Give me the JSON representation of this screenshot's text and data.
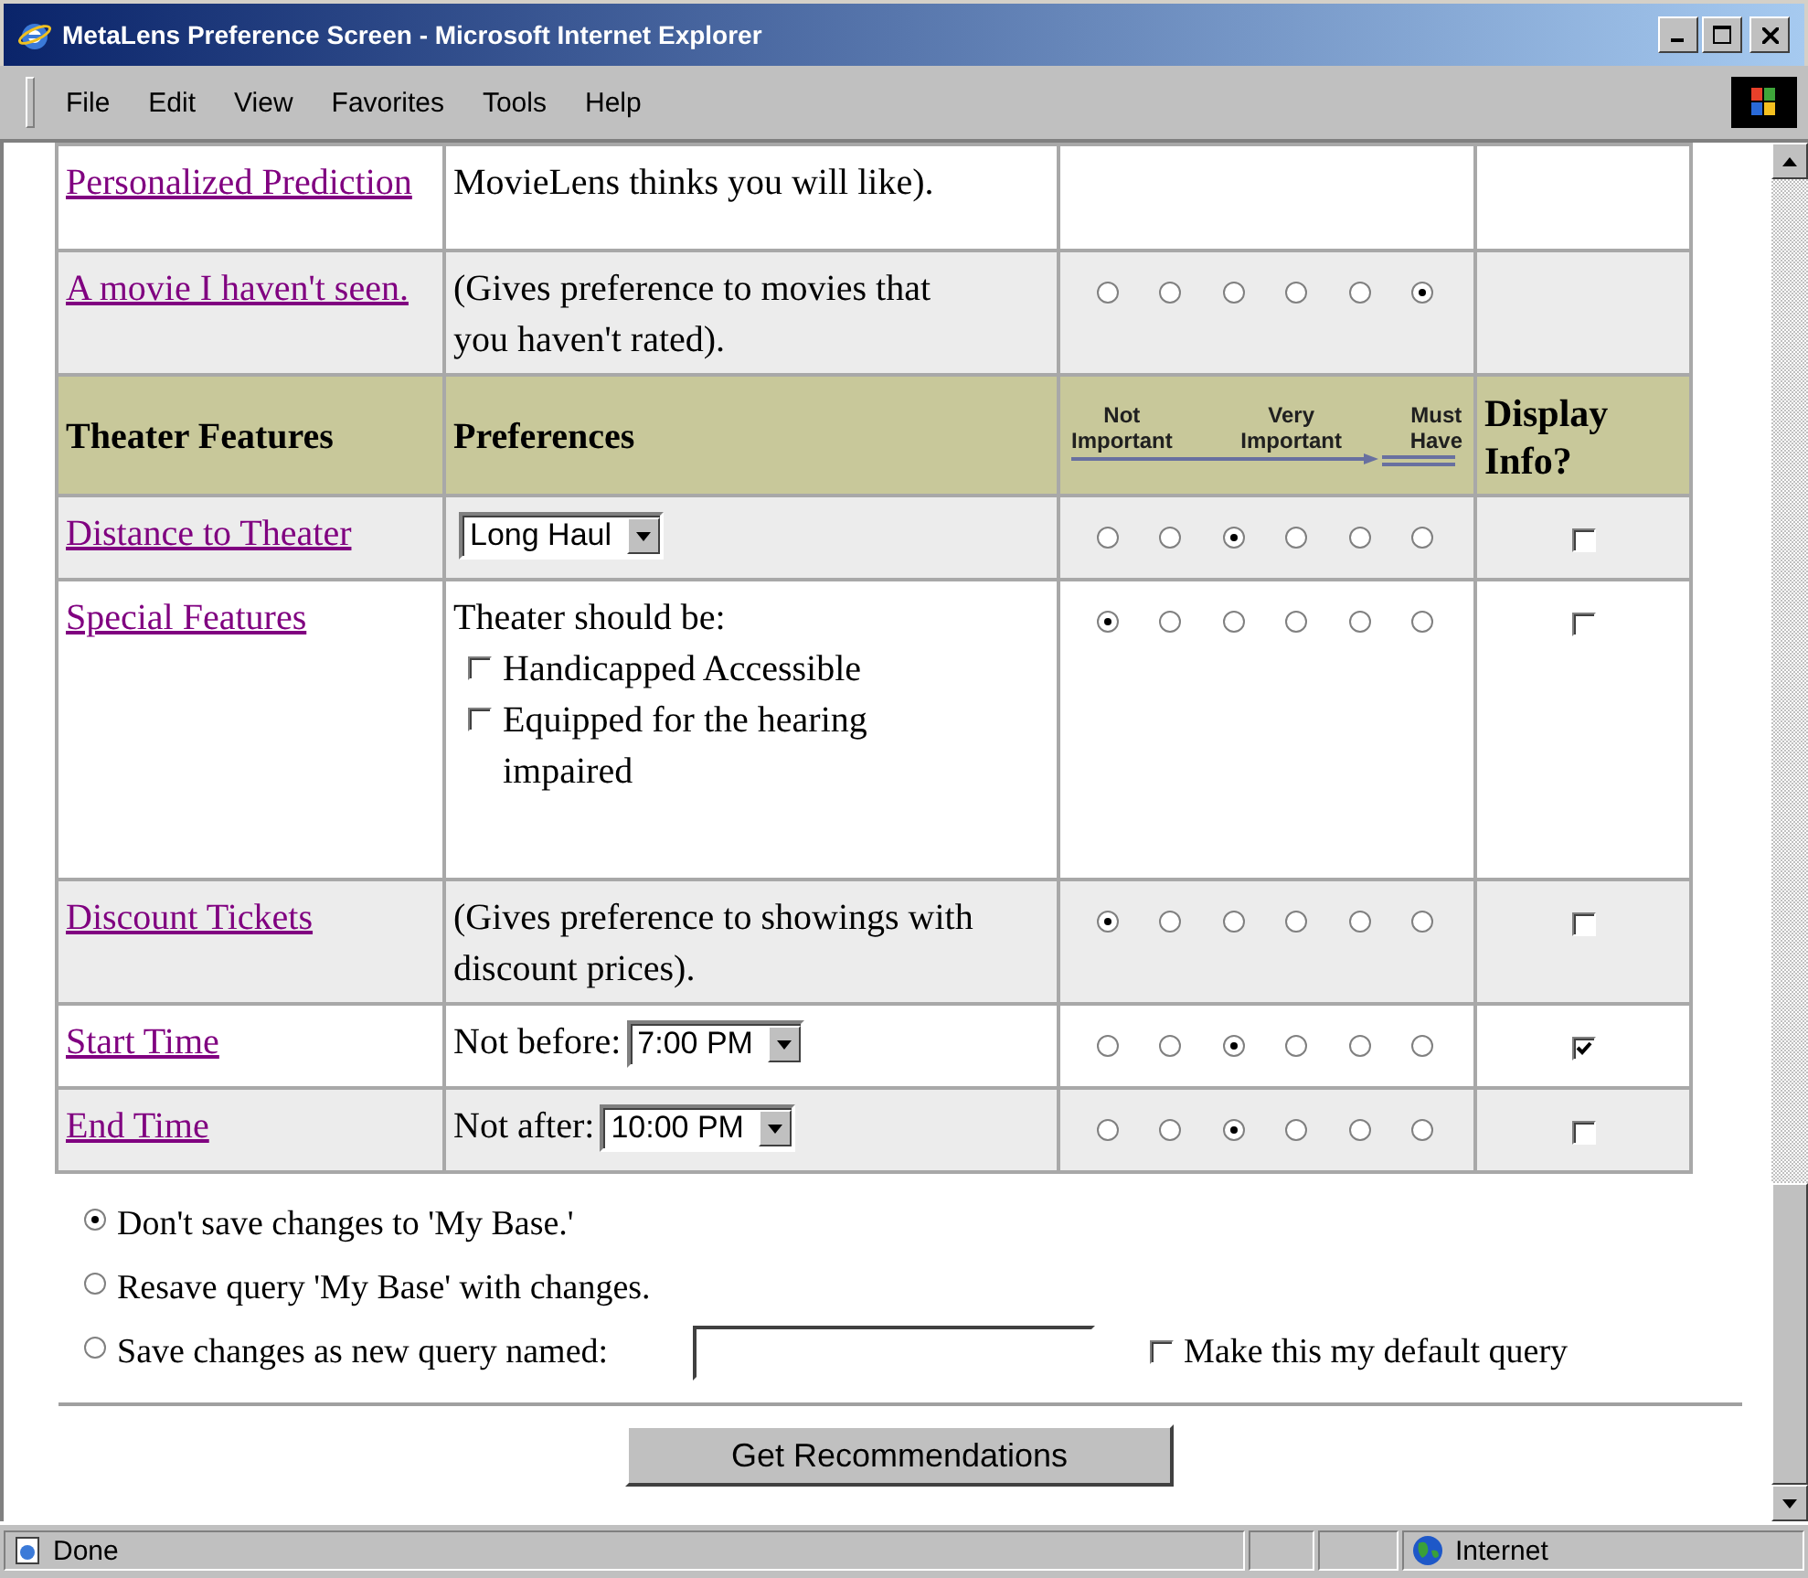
{
  "window": {
    "title": "MetaLens Preference Screen - Microsoft Internet Explorer"
  },
  "menu": [
    {
      "label": "File"
    },
    {
      "label": "Edit"
    },
    {
      "label": "View"
    },
    {
      "label": "Favorites"
    },
    {
      "label": "Tools"
    },
    {
      "label": "Help"
    }
  ],
  "movie_rows": [
    {
      "feature": "Personalized Prediction",
      "preference": {
        "kind": "text",
        "text": "MovieLens thinks you will like)."
      }
    },
    {
      "feature": "A movie I haven't seen.",
      "preference": {
        "kind": "text",
        "text": "(Gives preference to movies that you haven't rated)."
      },
      "ratings": [
        {
          "selected": false
        },
        {
          "selected": false
        },
        {
          "selected": false
        },
        {
          "selected": false
        },
        {
          "selected": false
        },
        {
          "selected": true
        }
      ]
    }
  ],
  "header": {
    "feature": "Theater Features",
    "preferences": "Preferences",
    "scale_low": "Not Important",
    "scale_mid": "Very Important",
    "scale_high": "Must Have",
    "display": "Display Info?"
  },
  "theater_rows": [
    {
      "feature": "Distance to Theater",
      "preference": {
        "kind": "select",
        "value": "Long Haul"
      },
      "ratings": [
        {
          "selected": false
        },
        {
          "selected": false
        },
        {
          "selected": true
        },
        {
          "selected": false
        },
        {
          "selected": false
        },
        {
          "selected": false
        }
      ],
      "display_info": {
        "checked": false
      }
    },
    {
      "feature": "Special Features",
      "preference": {
        "kind": "checklist",
        "label": "Theater should be:",
        "items": [
          {
            "label": "Handicapped Accessible",
            "checked": false
          },
          {
            "label": "Equipped for the hearing impaired",
            "checked": false
          }
        ]
      },
      "ratings": [
        {
          "selected": true
        },
        {
          "selected": false
        },
        {
          "selected": false
        },
        {
          "selected": false
        },
        {
          "selected": false
        },
        {
          "selected": false
        }
      ],
      "display_info": {
        "checked": false
      }
    },
    {
      "feature": "Discount Tickets",
      "preference": {
        "kind": "text",
        "text": "(Gives preference to showings with discount prices)."
      },
      "ratings": [
        {
          "selected": true
        },
        {
          "selected": false
        },
        {
          "selected": false
        },
        {
          "selected": false
        },
        {
          "selected": false
        },
        {
          "selected": false
        }
      ],
      "display_info": {
        "checked": false
      }
    },
    {
      "feature": "Start Time",
      "preference": {
        "kind": "select",
        "label": "Not before:",
        "value": "7:00 PM"
      },
      "ratings": [
        {
          "selected": false
        },
        {
          "selected": false
        },
        {
          "selected": true
        },
        {
          "selected": false
        },
        {
          "selected": false
        },
        {
          "selected": false
        }
      ],
      "display_info": {
        "checked": true
      }
    },
    {
      "feature": "End Time",
      "preference": {
        "kind": "select",
        "label": "Not after:",
        "value": "10:00 PM"
      },
      "ratings": [
        {
          "selected": false
        },
        {
          "selected": false
        },
        {
          "selected": true
        },
        {
          "selected": false
        },
        {
          "selected": false
        },
        {
          "selected": false
        }
      ],
      "display_info": {
        "checked": false
      }
    }
  ],
  "save_options": [
    {
      "label": "Don't save changes to 'My Base.'",
      "selected": true
    },
    {
      "label": "Resave query 'My Base' with changes.",
      "selected": false
    },
    {
      "label": "Save changes as new query named:",
      "selected": false
    }
  ],
  "default_query": {
    "label": "Make this my default query",
    "checked": false
  },
  "submit": "Get Recommendations",
  "status_bar": {
    "text": "Done",
    "zone": "Internet"
  }
}
